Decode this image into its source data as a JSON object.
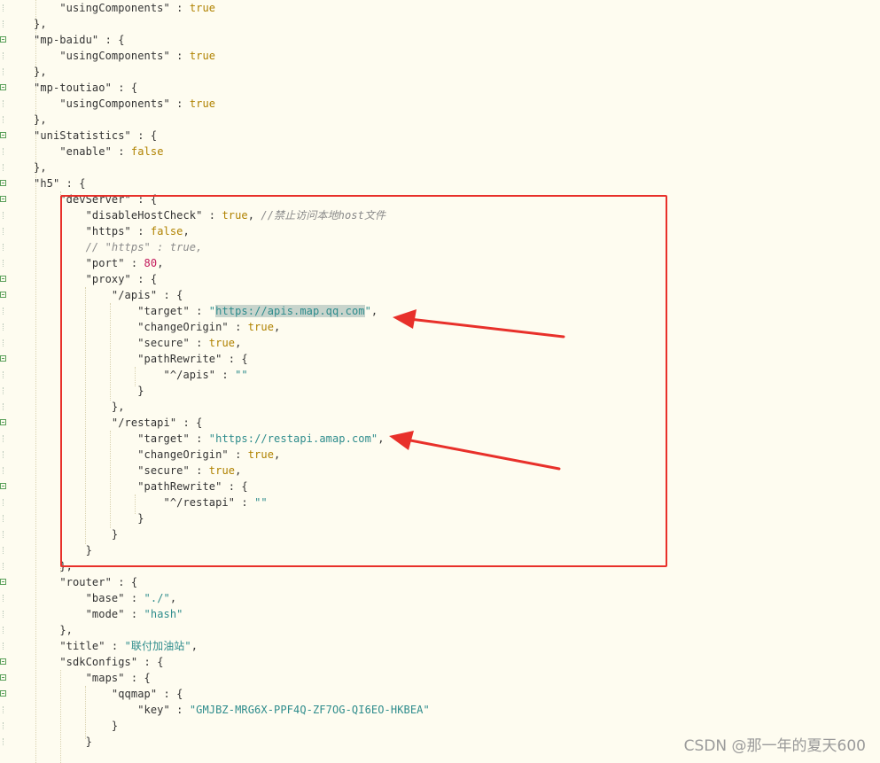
{
  "code": {
    "l01": "\"usingComponents\"",
    "true": "true",
    "false": "false",
    "mp_baidu": "\"mp-baidu\"",
    "mp_toutiao": "\"mp-toutiao\"",
    "uniStatistics": "\"uniStatistics\"",
    "enable": "\"enable\"",
    "h5": "\"h5\"",
    "devServer": "\"devServer\"",
    "disableHostCheck": "\"disableHostCheck\"",
    "comment_host": "//禁止访问本地host文件",
    "https_key": "\"https\"",
    "comment_https": "// \"https\" : true,",
    "port_key": "\"port\"",
    "port_val": "80",
    "proxy": "\"proxy\"",
    "apis": "\"/apis\"",
    "target": "\"target\"",
    "apis_url_q": "\"",
    "apis_url": "https://apis.map.qq.com",
    "changeOrigin": "\"changeOrigin\"",
    "secure": "\"secure\"",
    "pathRewrite": "\"pathRewrite\"",
    "apis_rw_key": "\"^/apis\"",
    "empty": "\"\"",
    "restapi": "\"/restapi\"",
    "restapi_url": "\"https://restapi.amap.com\"",
    "restapi_rw_key": "\"^/restapi\"",
    "router": "\"router\"",
    "base": "\"base\"",
    "base_val": "\"./\"",
    "mode": "\"mode\"",
    "mode_val": "\"hash\"",
    "title_key": "\"title\"",
    "title_val": "\"联付加油站\"",
    "sdkConfigs": "\"sdkConfigs\"",
    "maps": "\"maps\"",
    "qqmap": "\"qqmap\"",
    "key": "\"key\"",
    "key_val": "\"GMJBZ-MRG6X-PPF4Q-ZF7OG-QI6EO-HKBEA\""
  },
  "annotation": {
    "box_color": "#e8302a",
    "arrow_color": "#e8302a"
  },
  "watermark": "CSDN @那一年的夏天600"
}
